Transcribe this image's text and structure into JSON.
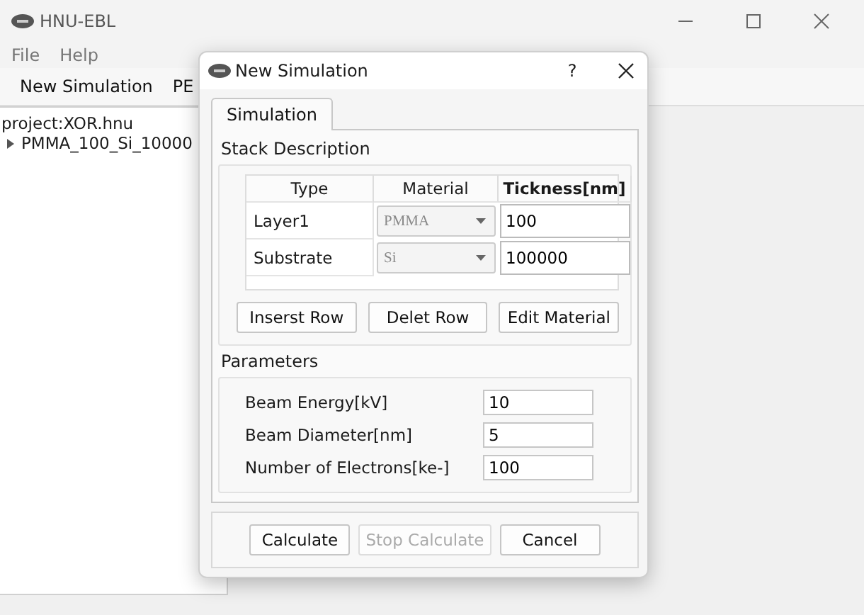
{
  "window": {
    "title": "HNU-EBL"
  },
  "menu": [
    "File",
    "Help"
  ],
  "toolbar": [
    "New Simulation",
    "PE"
  ],
  "tree": {
    "header": "project:XOR.hnu",
    "items": [
      {
        "label": "PMMA_100_Si_10000",
        "expanded": false
      }
    ]
  },
  "dialog": {
    "title": "New Simulation",
    "help": "?",
    "tabs": [
      {
        "label": "Simulation",
        "selected": true
      }
    ],
    "stack": {
      "title": "Stack Description",
      "columns": [
        {
          "label": "Type",
          "selected": false
        },
        {
          "label": "Material",
          "selected": false
        },
        {
          "label": "Tickness[nm]",
          "selected": true
        }
      ],
      "rows": [
        {
          "type": "Layer1",
          "material": "PMMA",
          "thickness": "100"
        },
        {
          "type": "Substrate",
          "material": "Si",
          "thickness": "100000"
        }
      ],
      "buttons": [
        "Inserst Row",
        "Delet Row",
        "Edit Material"
      ]
    },
    "parameters": {
      "title": "Parameters",
      "fields": [
        {
          "label": "Beam Energy[kV]",
          "value": "10"
        },
        {
          "label": "Beam Diameter[nm]",
          "value": "5"
        },
        {
          "label": "Number of Electrons[ke-]",
          "value": "100"
        }
      ]
    },
    "buttons": [
      {
        "label": "Calculate",
        "disabled": false
      },
      {
        "label": "Stop Calculate",
        "disabled": true
      },
      {
        "label": "Cancel",
        "disabled": false
      }
    ]
  }
}
